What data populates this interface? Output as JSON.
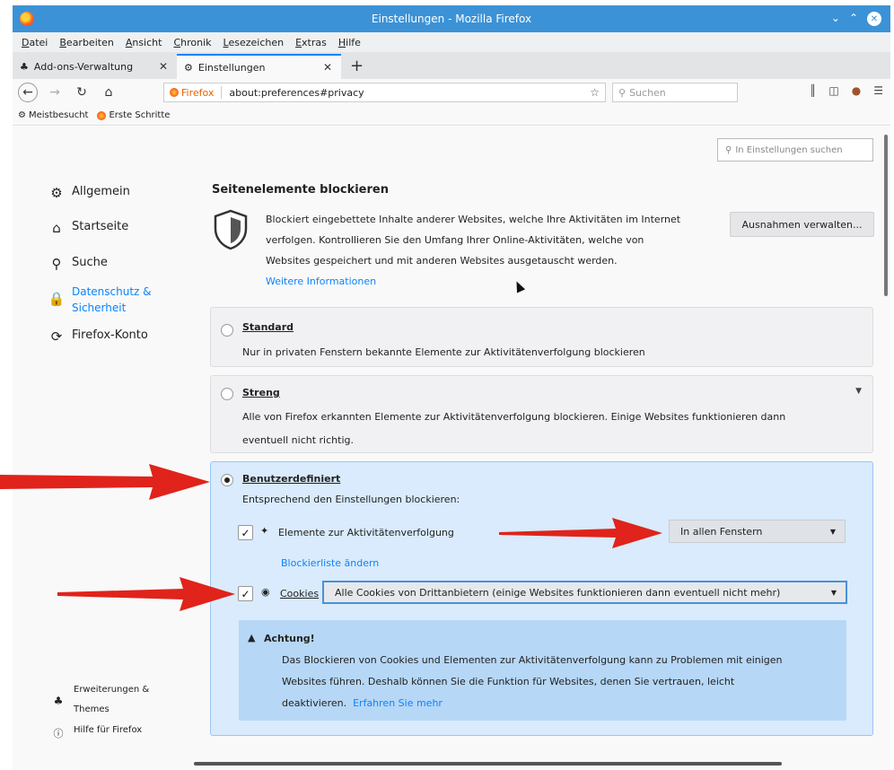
{
  "window": {
    "title": "Einstellungen - Mozilla Firefox"
  },
  "menu": [
    "Datei",
    "Bearbeiten",
    "Ansicht",
    "Chronik",
    "Lesezeichen",
    "Extras",
    "Hilfe"
  ],
  "tabs": [
    {
      "label": "Add-ons-Verwaltung"
    },
    {
      "label": "Einstellungen"
    }
  ],
  "urlbar": {
    "brand": "Firefox",
    "url": "about:preferences#privacy"
  },
  "searchbar": {
    "placeholder": "Suchen"
  },
  "bookmarks": [
    "Meistbesucht",
    "Erste Schritte"
  ],
  "find": {
    "placeholder": "In Einstellungen suchen"
  },
  "sidebar": {
    "items": [
      "Allgemein",
      "Startseite",
      "Suche",
      "Datenschutz &",
      "Sicherheit",
      "Firefox-Konto"
    ],
    "bottom": [
      "Erweiterungen &",
      "Themes",
      "Hilfe für Firefox"
    ]
  },
  "section": {
    "title": "Seitenelemente blockieren",
    "desc1": "Blockiert eingebettete Inhalte anderer Websites, welche Ihre Aktivitäten im Internet",
    "desc2": "verfolgen. Kontrollieren Sie den Umfang Ihrer Online-Aktivitäten, welche von",
    "desc3": "Websites gespeichert und mit anderen Websites ausgetauscht werden.",
    "more": "Weitere Informationen",
    "manage": "Ausnahmen verwalten..."
  },
  "options": {
    "standard": {
      "title": "Standard",
      "desc": "Nur in privaten Fenstern bekannte Elemente zur Aktivitätenverfolgung blockieren"
    },
    "streng": {
      "title": "Streng",
      "desc1": "Alle von Firefox erkannten Elemente zur Aktivitätenverfolgung blockieren. Einige Websites funktionieren dann",
      "desc2": "eventuell nicht richtig."
    },
    "custom": {
      "title": "Benutzerdefiniert",
      "desc": "Entsprechend den Einstellungen blockieren:",
      "trackers_label": "Elemente zur Aktivitätenverfolgung",
      "trackers_value": "In allen Fenstern",
      "blocklist": "Blockierliste ändern",
      "cookies_label": "Cookies",
      "cookies_value": "Alle Cookies von Drittanbietern (einige Websites funktionieren dann eventuell nicht mehr)"
    }
  },
  "warning": {
    "title": "Achtung!",
    "line1": "Das Blockieren von Cookies und Elementen zur Aktivitätenverfolgung kann zu Problemen mit einigen",
    "line2": "Websites führen. Deshalb können Sie die Funktion für Websites, denen Sie vertrauen, leicht",
    "line3": "deaktivieren.",
    "link": "Erfahren Sie mehr"
  },
  "colors": {
    "accent": "#0a84ff",
    "titlebar": "#3c92d6",
    "arrow": "#e0231b",
    "selected_bg": "#d9ebfc",
    "warning_bg": "#b6d7f6"
  }
}
